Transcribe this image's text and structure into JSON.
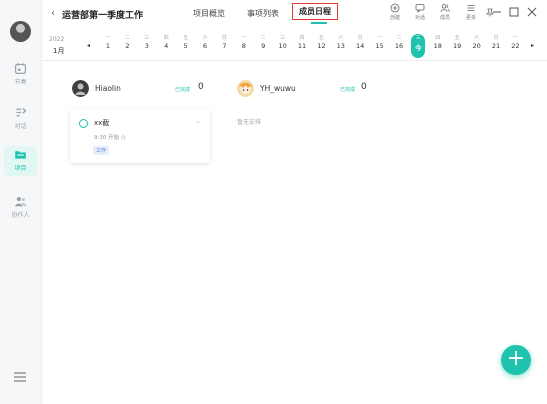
{
  "sidebar": {
    "items": [
      {
        "label": "节奏",
        "icon": "calendar-icon"
      },
      {
        "label": "对话",
        "icon": "chat-icon"
      },
      {
        "label": "项目",
        "icon": "folder-icon"
      },
      {
        "label": "协作人",
        "icon": "people-icon"
      }
    ]
  },
  "header": {
    "title": "运营部第一季度工作",
    "tabs": [
      {
        "label": "项目概览"
      },
      {
        "label": "事项列表"
      },
      {
        "label": "成员日程"
      }
    ],
    "tools": [
      {
        "label": "创建",
        "icon": "plus-circle-icon"
      },
      {
        "label": "对话",
        "icon": "chat-icon"
      },
      {
        "label": "成员",
        "icon": "members-icon"
      },
      {
        "label": "更多",
        "icon": "more-icon"
      }
    ]
  },
  "calendar": {
    "year": "2022",
    "month": "1月",
    "days": [
      {
        "wd": "一",
        "dn": "1"
      },
      {
        "wd": "二",
        "dn": "2"
      },
      {
        "wd": "三",
        "dn": "3"
      },
      {
        "wd": "四",
        "dn": "4"
      },
      {
        "wd": "五",
        "dn": "5"
      },
      {
        "wd": "六",
        "dn": "6"
      },
      {
        "wd": "日",
        "dn": "7"
      },
      {
        "wd": "一",
        "dn": "8"
      },
      {
        "wd": "二",
        "dn": "9"
      },
      {
        "wd": "三",
        "dn": "10"
      },
      {
        "wd": "四",
        "dn": "11"
      },
      {
        "wd": "五",
        "dn": "12"
      },
      {
        "wd": "六",
        "dn": "13"
      },
      {
        "wd": "日",
        "dn": "14"
      },
      {
        "wd": "一",
        "dn": "15"
      },
      {
        "wd": "二",
        "dn": "16"
      },
      {
        "wd": "三",
        "dn": "今"
      },
      {
        "wd": "四",
        "dn": "18"
      },
      {
        "wd": "五",
        "dn": "19"
      },
      {
        "wd": "六",
        "dn": "20"
      },
      {
        "wd": "日",
        "dn": "21"
      },
      {
        "wd": "一",
        "dn": "22"
      }
    ]
  },
  "members": [
    {
      "name": "Hiaolin",
      "done_label": "已完成",
      "done_count": "0"
    },
    {
      "name": "YH_wuwu",
      "done_label": "已完成",
      "done_count": "0"
    }
  ],
  "task": {
    "title": "xx截",
    "time": "9:30 开始",
    "tag": "工作"
  },
  "no_schedule": "暂无安排",
  "fab_label": "+",
  "colors": {
    "accent": "#1ec3ad",
    "highlight": "#e53935"
  }
}
